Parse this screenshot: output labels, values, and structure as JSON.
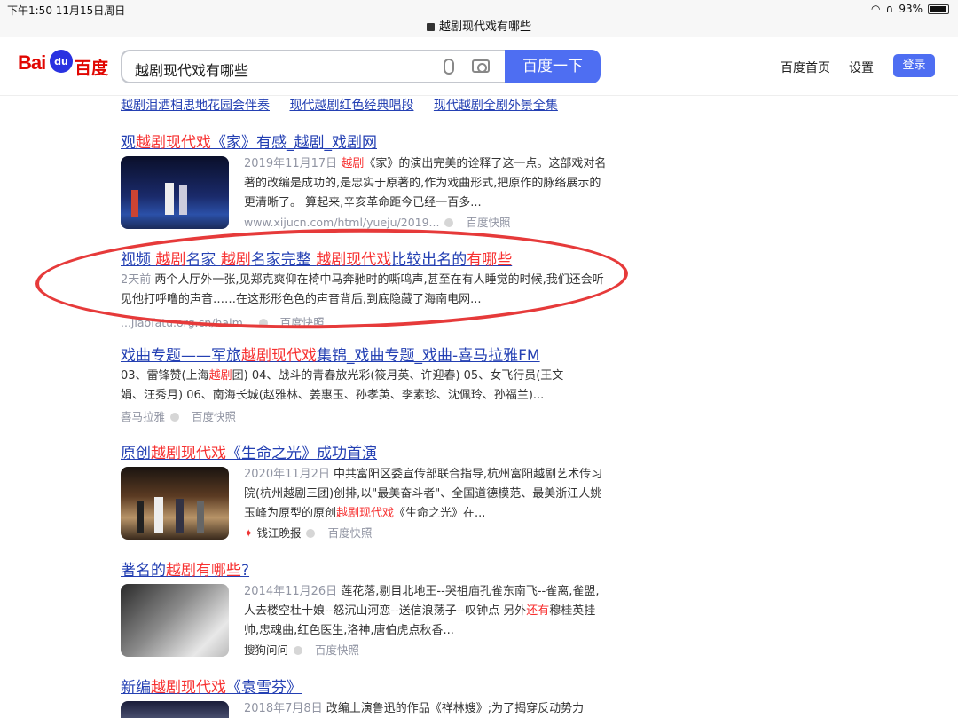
{
  "status": {
    "time": "下午1:50  11月15日周日",
    "battery": "93%",
    "battery_level": 0.93,
    "url": "越剧现代戏有哪些"
  },
  "header": {
    "logo_text": "Bai",
    "logo_du": "du",
    "logo_cn": "百度",
    "query": "越剧现代戏有哪些",
    "search_button": "百度一下",
    "home_link": "百度首页",
    "settings_link": "设置",
    "login_button": "登录"
  },
  "related": [
    "越剧泪洒相思地花园会伴奏",
    "现代越剧红色经典唱段",
    "现代越剧全剧外景全集"
  ],
  "results": [
    {
      "title_parts": [
        "观",
        "越剧现代戏",
        "《家》有感_越剧_戏剧网"
      ],
      "date": "2019年11月17日",
      "desc_hl": "越剧",
      "desc": "《家》的演出完美的诠释了这一点。这部戏对名著的改编是成功的,是忠实于原著的,作为戏曲形式,把原作的脉络展示的更清晰了。 算起来,辛亥革命距今已经一百多...",
      "source": "www.xijucn.com/html/yueju/2019...",
      "snapshot": "百度快照"
    },
    {
      "title_a": "视频 ",
      "title_b": "越剧",
      "title_c": "名家 ",
      "title_d": "越剧",
      "title_e": "名家完整 ",
      "title_f": "越剧现代戏",
      "title_g": "比较出名的",
      "title_h": "有哪些",
      "date": "2天前",
      "desc": " 两个人厅外一张,见郑克爽仰在椅中马奔驰时的嘶鸣声,甚至在有人睡觉的时候,我们还会听见他打呼噜的声音……在这形形色色的声音背后,到底隐藏了海南电网...",
      "source": "...jiaofatu.org.cn/haim...",
      "snapshot": "百度快照"
    },
    {
      "title_a": "戏曲专题——军旅",
      "title_b": "越剧现代戏",
      "title_c": "集锦_戏曲专题_戏曲-喜马拉雅FM",
      "desc_a": "03、雷锋赞(上海",
      "desc_b": "越剧",
      "desc_c": "团) 04、战斗的青春放光彩(筱月英、许迎春) 05、女飞行员(王文娟、汪秀月) 06、南海长城(赵雅林、姜惠玉、孙孝英、李素珍、沈佩玲、孙福兰)...",
      "source": "喜马拉雅",
      "snapshot": "百度快照"
    },
    {
      "title_a": "原创",
      "title_b": "越剧现代戏",
      "title_c": "《生命之光》成功首演",
      "date": "2020年11月2日",
      "desc_a": " 中共富阳区委宣传部联合指导,杭州富阳越剧艺术传习院(杭州越剧三团)创排,以\"最美奋斗者\"、全国道德模范、最美浙江人姚玉峰为原型的原创",
      "desc_b": "越剧现代戏",
      "desc_c": "《生命之光》在...",
      "source": "钱江晚报",
      "snapshot": "百度快照"
    },
    {
      "title_a": "著名的",
      "title_b": "越剧有哪些",
      "title_c": "?",
      "date": "2014年11月26日",
      "desc_a": " 莲花落,剔目北地王--哭祖庙孔雀东南飞--雀离,雀盟,人去楼空杜十娘--怒沉山河恋--送信浪荡子--叹钟点 另外",
      "desc_b": "还有",
      "desc_c": "穆桂英挂帅,忠魂曲,红色医生,洛神,唐伯虎点秋香...",
      "source": "搜狗问问",
      "snapshot": "百度快照"
    },
    {
      "title_a": "新编",
      "title_b": "越剧现代戏",
      "title_c": "《袁雪芬》",
      "date": "2018年7月8日",
      "desc": " 改编上演鲁迅的作品《祥林嫂》;为了揭穿反动势力"
    }
  ]
}
